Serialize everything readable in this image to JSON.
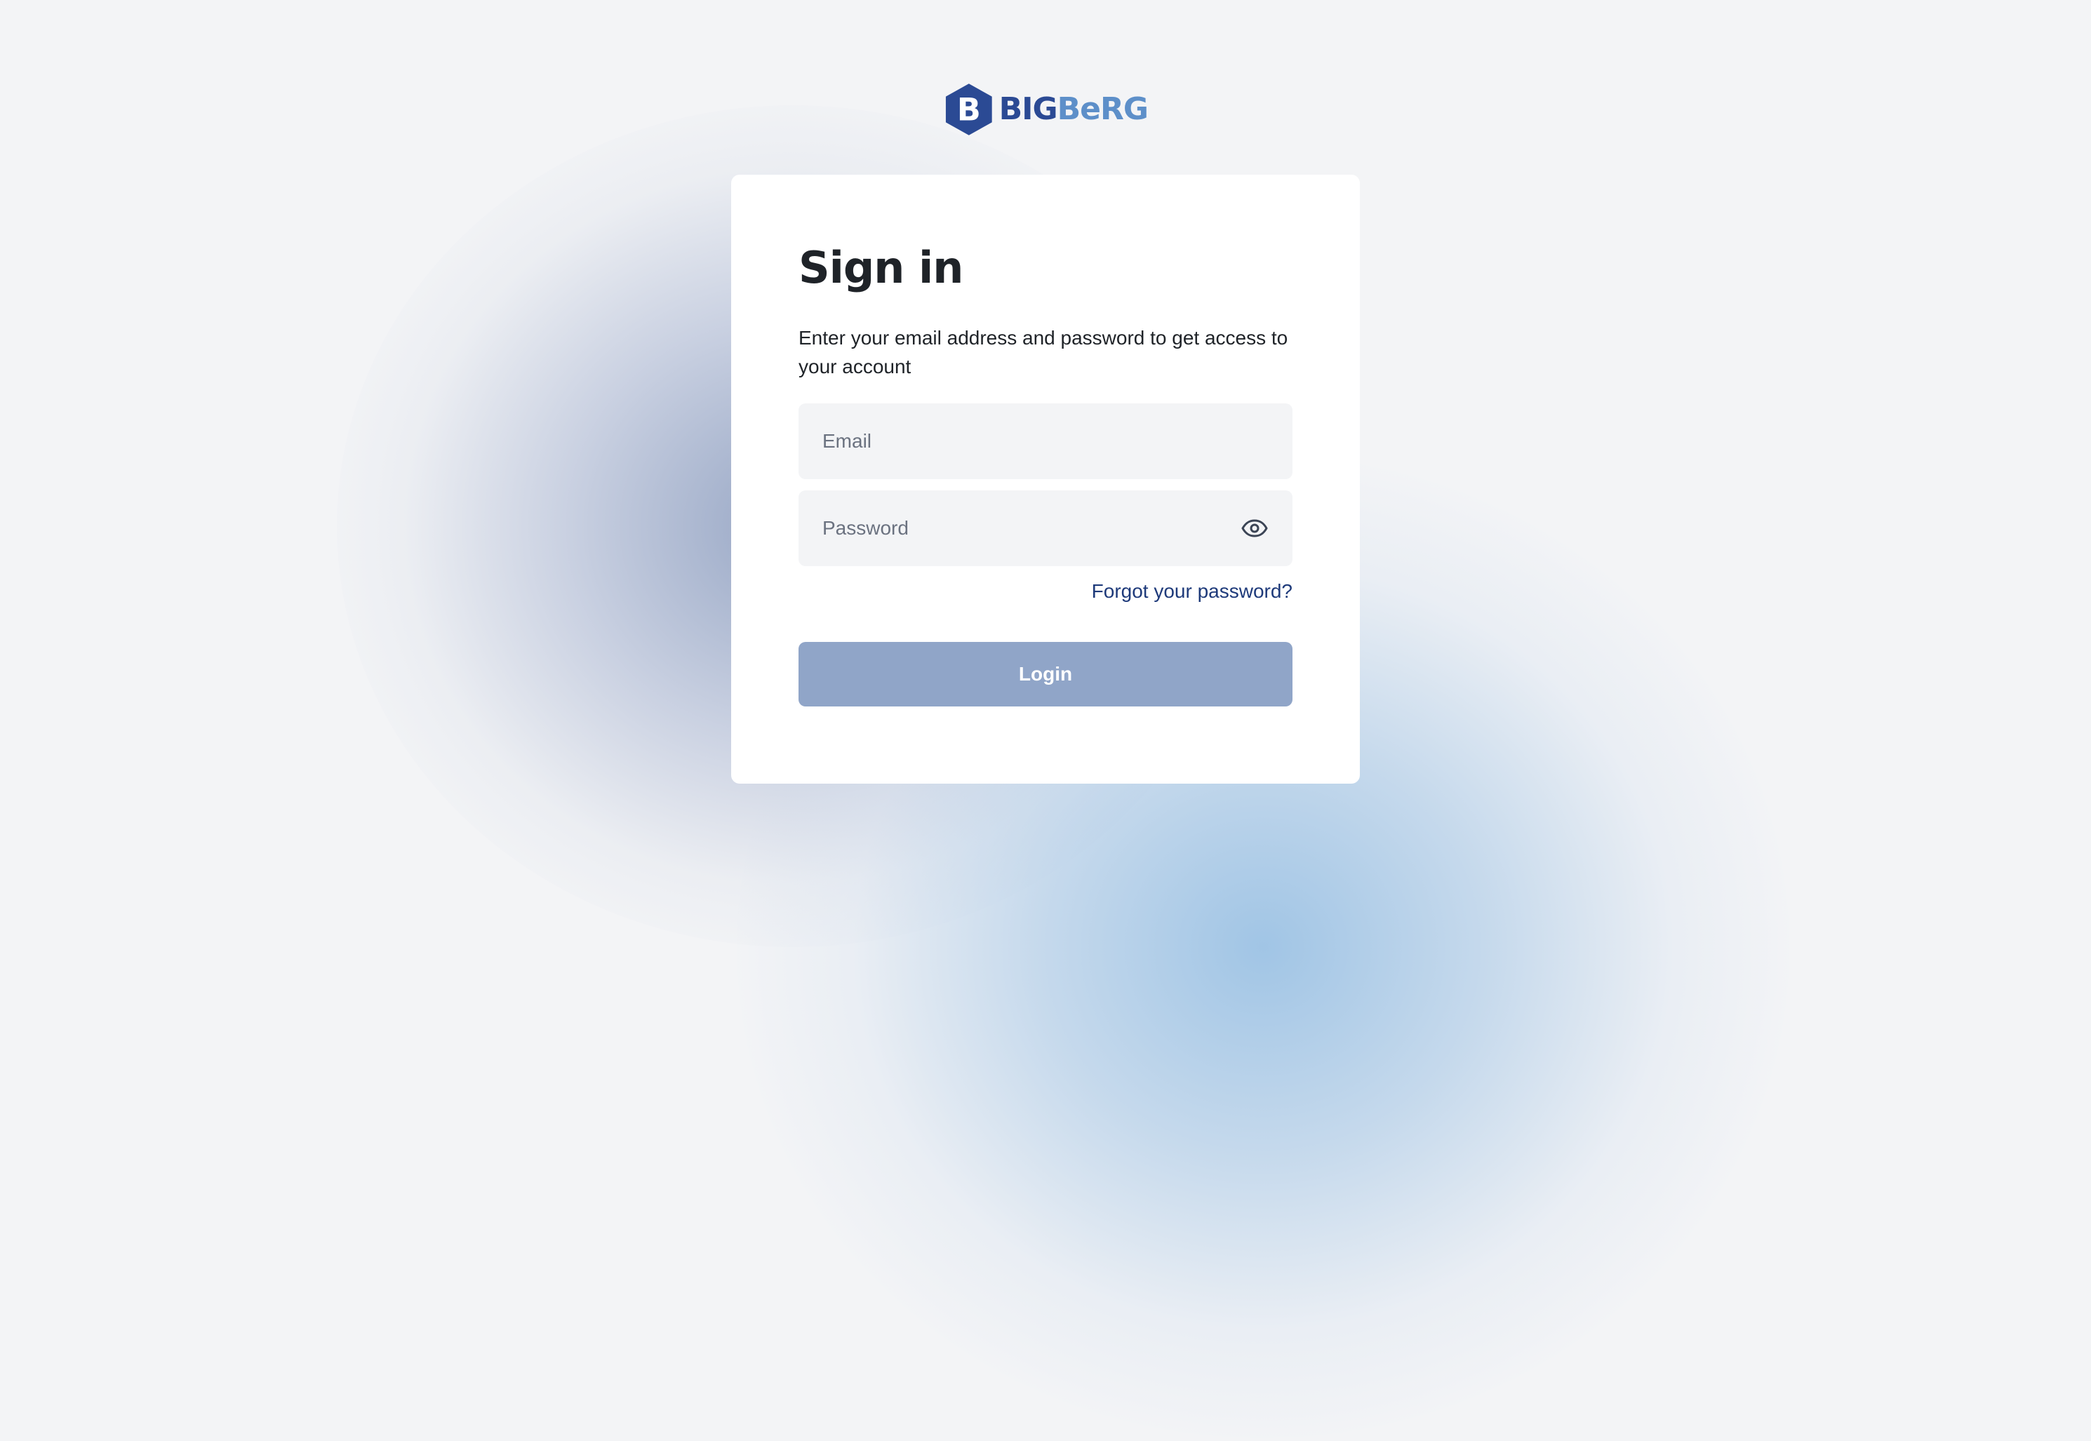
{
  "brand": {
    "logo_parts": [
      "BIG",
      "BeRG"
    ],
    "colors": {
      "primary": "#2b4a94",
      "secondary": "#5d8fc9"
    }
  },
  "signin": {
    "title": "Sign in",
    "subtitle": "Enter your email address and password to get access to your account",
    "email_placeholder": "Email",
    "password_placeholder": "Password",
    "forgot_label": "Forgot your password?",
    "login_label": "Login",
    "icons": {
      "password_toggle": "eye-icon"
    }
  },
  "colors": {
    "background": "#f3f4f6",
    "card": "#ffffff",
    "input_bg": "#f3f4f6",
    "link": "#1e3a7a",
    "button_disabled": "#90a5c8",
    "text": "#1f2328"
  }
}
